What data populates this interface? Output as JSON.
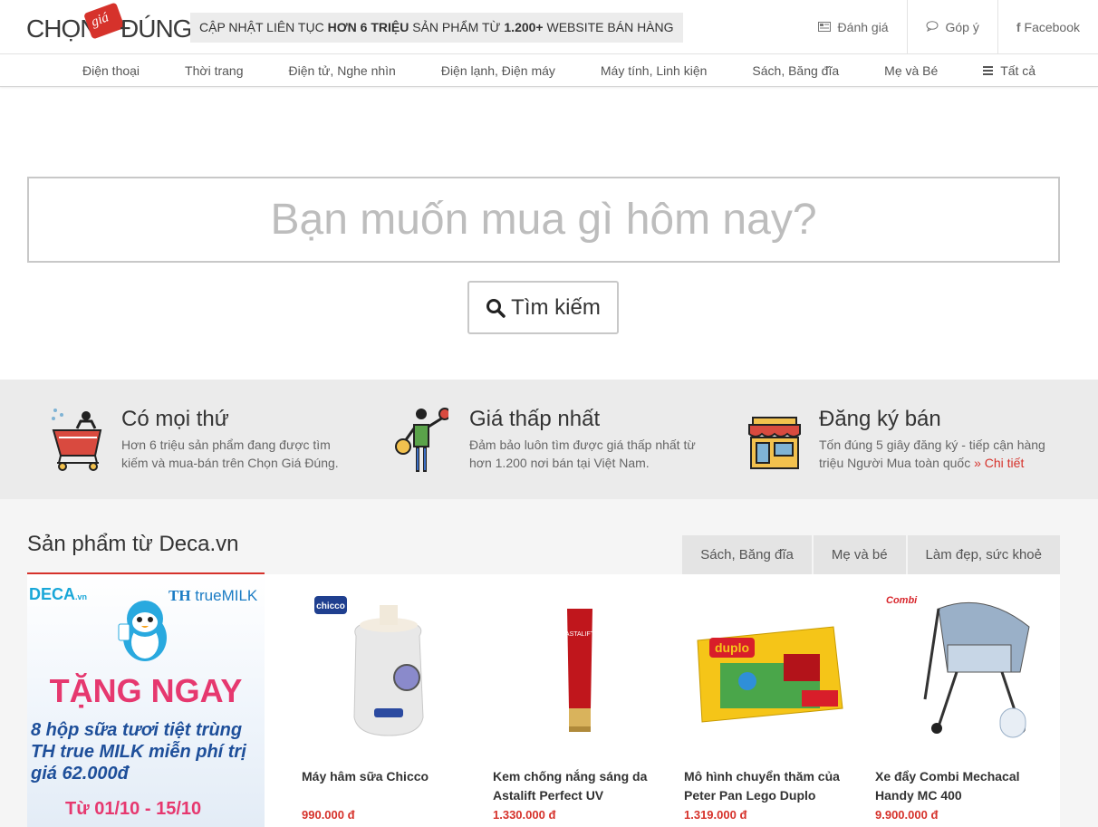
{
  "header": {
    "logo": {
      "word1": "CHỌN",
      "tag": "giá",
      "word2": "ĐÚNG"
    },
    "tagline": {
      "part1": "CẬP NHẬT LIÊN TỤC ",
      "bold1": "HƠN 6 TRIỆU",
      "part2": " SẢN PHẨM TỪ ",
      "bold2": "1.200+",
      "part3": " WEBSITE BÁN HÀNG"
    },
    "links": [
      {
        "label": "Đánh giá",
        "icon": "review-icon"
      },
      {
        "label": "Góp ý",
        "icon": "comment-icon"
      },
      {
        "label": "Facebook",
        "icon": "facebook-icon"
      }
    ]
  },
  "nav": {
    "items": [
      "Điện thoại",
      "Thời trang",
      "Điện tử, Nghe nhìn",
      "Điện lạnh, Điện máy",
      "Máy tính, Linh kiện",
      "Sách, Băng đĩa",
      "Mẹ và Bé"
    ],
    "all_label": "Tất cả"
  },
  "search": {
    "placeholder": "Bạn muốn mua gì hôm nay?",
    "value": "",
    "button_label": "Tìm kiếm"
  },
  "features": [
    {
      "title": "Có mọi thứ",
      "desc": "Hơn 6 triệu sản phẩm đang được tìm kiếm và mua-bán trên Chọn Giá Đúng.",
      "icon": "shopping-cart-icon"
    },
    {
      "title": "Giá thấp nhất",
      "desc": "Đảm bảo luôn tìm được giá thấp nhất từ hơn 1.200 nơi bán tại Việt Nam.",
      "icon": "juggler-icon"
    },
    {
      "title": "Đăng ký bán",
      "desc": "Tốn đúng 5 giây đăng ký - tiếp cận hàng triệu Người Mua toàn quốc",
      "more": "» Chi tiết",
      "icon": "store-icon"
    }
  ],
  "products_section": {
    "title": "Sản phẩm từ Deca.vn",
    "tabs": [
      "Sách, Băng đĩa",
      "Mẹ và bé",
      "Làm đẹp, sức khoẻ"
    ],
    "banner": {
      "brand": "DECA",
      "brand_suffix": ".vn",
      "partner_prefix": "TH",
      "partner": "trueMILK",
      "headline": "TẶNG NGAY",
      "body": "8 hộp sữa tươi tiệt trùng TH true MILK miễn phí trị giá 62.000đ",
      "dates": "Từ 01/10 - 15/10"
    },
    "products": [
      {
        "name": "Máy hâm sữa Chicco",
        "price": "990.000 đ",
        "brand_label": "chicco"
      },
      {
        "name": "Kem chống nắng sáng da Astalift Perfect UV",
        "price": "1.330.000 đ",
        "brand_label": "ASTALIFT"
      },
      {
        "name": "Mô hình chuyển thăm của Peter Pan Lego Duplo",
        "price": "1.319.000 đ",
        "brand_label": "duplo"
      },
      {
        "name": "Xe đẩy Combi Mechacal Handy MC 400",
        "price": "9.900.000 đ",
        "brand_label": "Combi"
      }
    ]
  }
}
